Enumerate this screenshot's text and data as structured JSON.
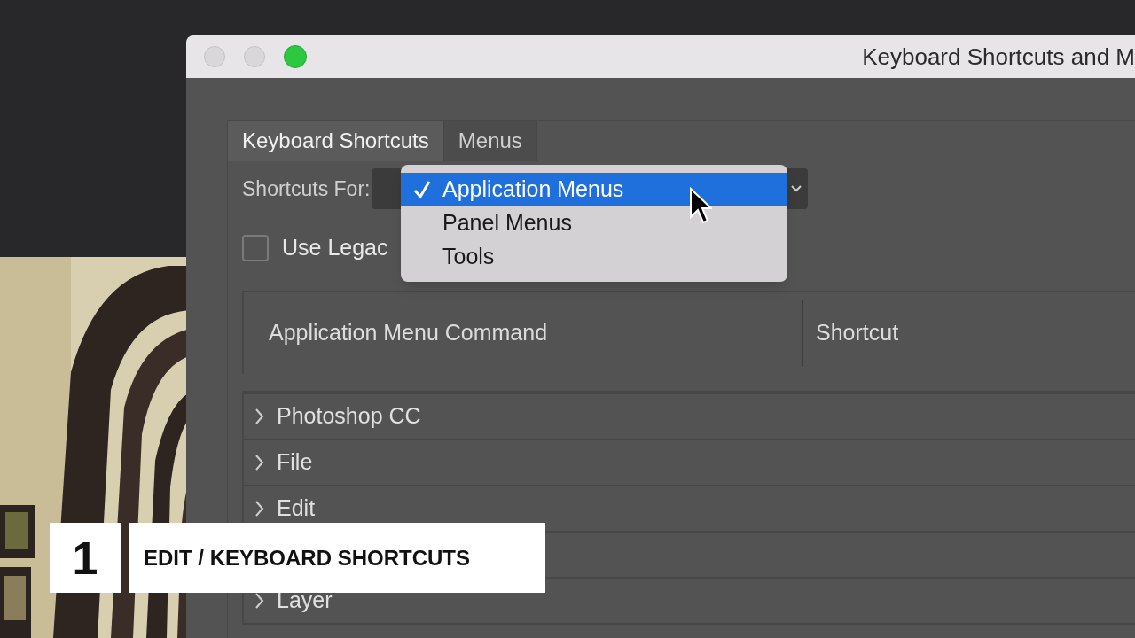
{
  "window": {
    "title": "Keyboard Shortcuts and M"
  },
  "tabs": [
    {
      "label": "Keyboard Shortcuts",
      "selected": true
    },
    {
      "label": "Menus",
      "selected": false
    }
  ],
  "shortcuts_for": {
    "label": "Shortcuts For:",
    "menu": [
      {
        "label": "Application Menus",
        "selected": true
      },
      {
        "label": "Panel Menus",
        "selected": false
      },
      {
        "label": "Tools",
        "selected": false
      }
    ]
  },
  "legacy_checkbox": {
    "label": "Use Legac",
    "checked": false
  },
  "table": {
    "columns": [
      "Application Menu Command",
      "Shortcut"
    ],
    "rows": [
      {
        "label": "Photoshop CC",
        "expanded": false
      },
      {
        "label": "File",
        "expanded": false
      },
      {
        "label": "Edit",
        "expanded": false
      },
      {
        "label": "Layer",
        "expanded": false
      }
    ]
  },
  "caption": {
    "number": "1",
    "text": "EDIT / KEYBOARD SHORTCUTS"
  }
}
